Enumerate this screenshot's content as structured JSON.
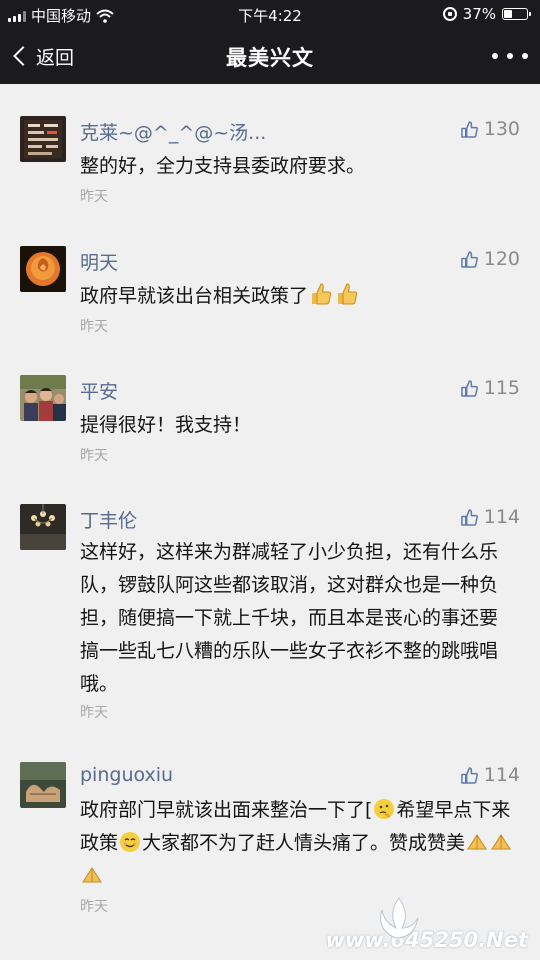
{
  "status_bar": {
    "carrier": "中国移动",
    "time": "下午4:22",
    "battery": "37%",
    "battery_level": 0.37
  },
  "nav": {
    "back_label": "返回",
    "title": "最美兴文"
  },
  "comments": [
    {
      "name": "克莱~@^_^@~汤...",
      "likes": "130",
      "text": "整的好，全力支持县委政府要求。",
      "time": "昨天"
    },
    {
      "name": "明天",
      "likes": "120",
      "text": "政府早就该出台相关政策了",
      "emoji": [
        "thumbs-up",
        "thumbs-up"
      ],
      "time": "昨天"
    },
    {
      "name": "平安",
      "likes": "115",
      "text": "提得很好！我支持！",
      "time": "昨天"
    },
    {
      "name": "丁丰伦",
      "likes": "114",
      "text": "这样好，这样来为群减轻了小少负担，还有什么乐队，锣鼓队阿这些都该取消，这对群众也是一种负担，随便搞一下就上千块，而且本是丧心的事还要搞一些乱七八糟的乐队一些女子衣衫不整的跳哦唱哦。",
      "time": "昨天"
    },
    {
      "name": "pinguoxiu",
      "likes": "114",
      "text_parts": [
        "政府部门早就该出面来整治一下了[",
        "希望早点下来政策",
        "大家都不为了赶人情头痛了。赞成赞美"
      ],
      "time": "昨天"
    }
  ],
  "watermark": "www.645250.Net",
  "colors": {
    "nav_bg": "#1b1b1d",
    "page_bg": "#f0f0f0",
    "name": "#586a8f",
    "meta": "#a8a8a8"
  }
}
